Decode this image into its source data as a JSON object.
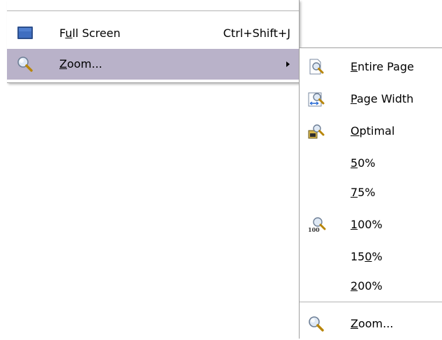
{
  "main_menu": {
    "items": [
      {
        "pre": "F",
        "key": "u",
        "post": "ll Screen",
        "shortcut": "Ctrl+Shift+J",
        "icon": "monitor-icon"
      },
      {
        "pre": "",
        "key": "Z",
        "post": "oom...",
        "shortcut": "",
        "icon": "magnifier-icon",
        "highlighted": true,
        "has_submenu": true
      }
    ]
  },
  "zoom_submenu": {
    "items": [
      {
        "pre": "",
        "key": "E",
        "post": "ntire Page",
        "icon": "zoom-entire-page-icon"
      },
      {
        "pre": "",
        "key": "P",
        "post": "age Width",
        "icon": "zoom-page-width-icon"
      },
      {
        "pre": "",
        "key": "O",
        "post": "ptimal",
        "icon": "zoom-optimal-icon"
      },
      {
        "pre": "",
        "key": "5",
        "post": "0%",
        "icon": ""
      },
      {
        "pre": "",
        "key": "7",
        "post": "5%",
        "icon": ""
      },
      {
        "pre": "",
        "key": "1",
        "post": "00%",
        "icon": "zoom-100-icon"
      },
      {
        "pre": "15",
        "key": "0",
        "post": "%",
        "icon": ""
      },
      {
        "pre": "",
        "key": "2",
        "post": "00%",
        "icon": ""
      },
      {
        "pre": "",
        "key": "Z",
        "post": "oom...",
        "icon": "magnifier-icon"
      }
    ]
  }
}
